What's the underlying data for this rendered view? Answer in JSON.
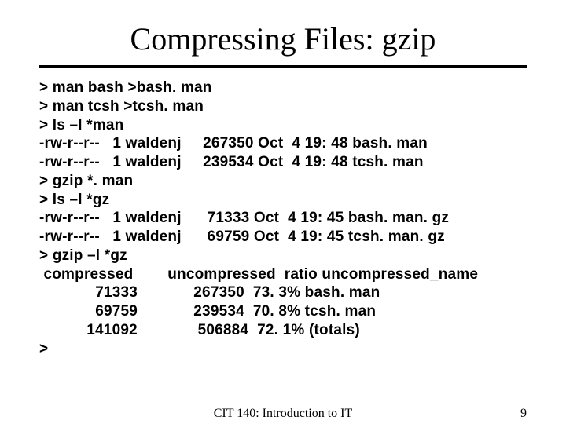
{
  "title": "Compressing Files: gzip",
  "terminal_lines": [
    "> man bash >bash. man",
    "> man tcsh >tcsh. man",
    "> ls –l *man",
    "-rw-r--r--   1 waldenj     267350 Oct  4 19: 48 bash. man",
    "-rw-r--r--   1 waldenj     239534 Oct  4 19: 48 tcsh. man",
    "> gzip *. man",
    "> ls –l *gz",
    "-rw-r--r--   1 waldenj      71333 Oct  4 19: 45 bash. man. gz",
    "-rw-r--r--   1 waldenj      69759 Oct  4 19: 45 tcsh. man. gz",
    "> gzip –l *gz",
    " compressed        uncompressed  ratio uncompressed_name",
    "             71333             267350  73. 3% bash. man",
    "             69759             239534  70. 8% tcsh. man",
    "           141092              506884  72. 1% (totals)",
    ">"
  ],
  "footer": {
    "course": "CIT 140: Introduction to IT",
    "page": "9"
  }
}
